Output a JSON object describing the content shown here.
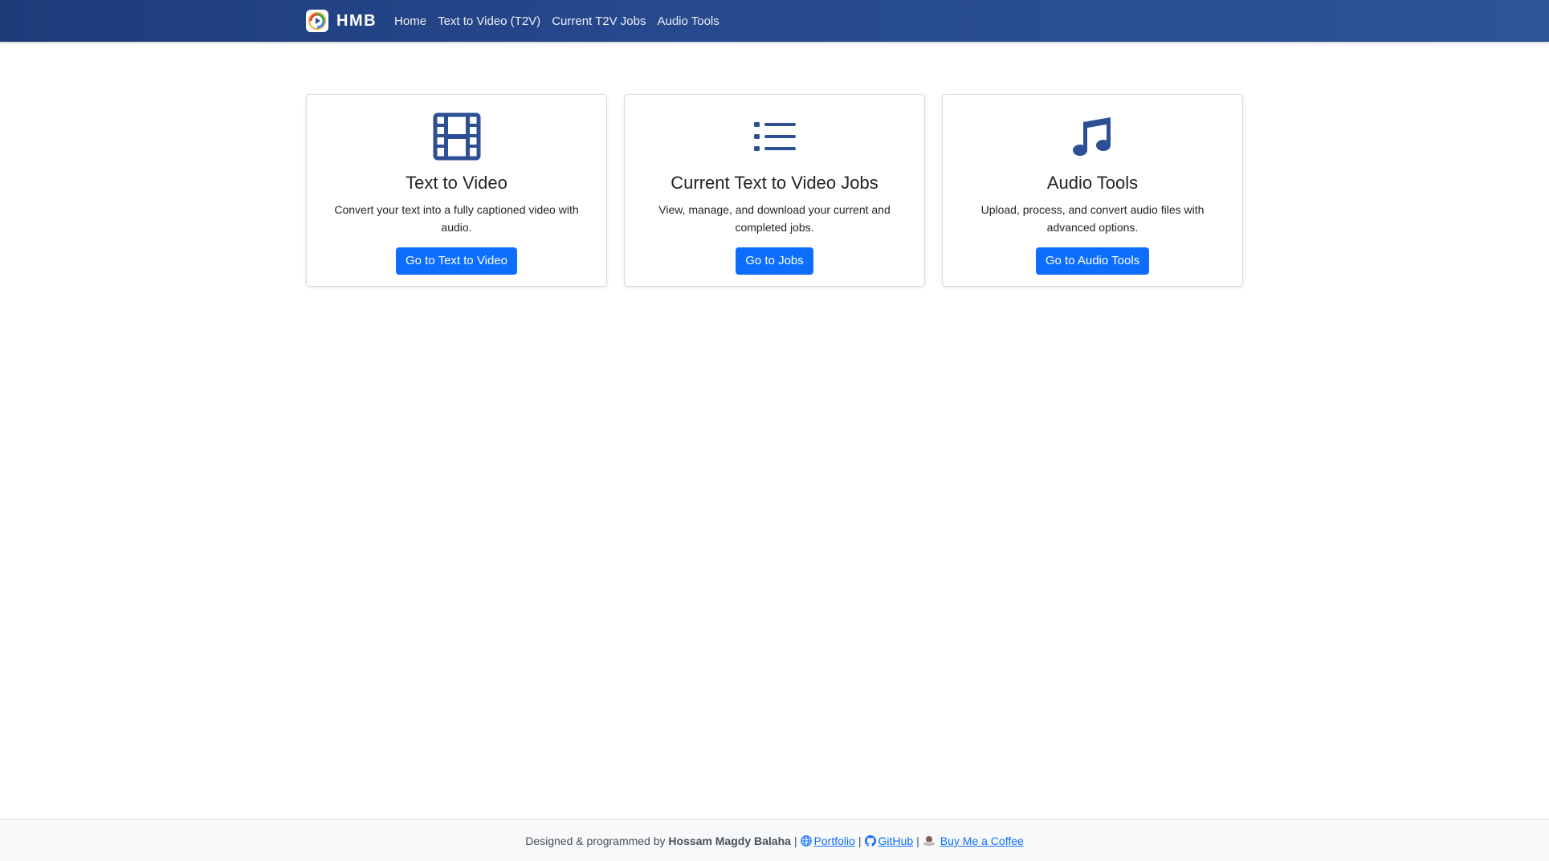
{
  "colors": {
    "navbar_start": "#1d3c7a",
    "navbar_end": "#2c5496",
    "icon_color": "#2d4f95",
    "button_primary": "#0d6efd",
    "link": "#0d6efd"
  },
  "navbar": {
    "brand": "HMB",
    "brand_icon": "hmb-logo-icon",
    "links": [
      {
        "label": "Home"
      },
      {
        "label": "Text to Video (T2V)"
      },
      {
        "label": "Current T2V Jobs"
      },
      {
        "label": "Audio Tools"
      }
    ]
  },
  "cards": [
    {
      "icon": "film-icon",
      "title": "Text to Video",
      "text": "Convert your text into a fully captioned video with audio.",
      "button": "Go to Text to Video"
    },
    {
      "icon": "list-icon",
      "title": "Current Text to Video Jobs",
      "text": "View, manage, and download your current and completed jobs.",
      "button": "Go to Jobs"
    },
    {
      "icon": "music-note-icon",
      "title": "Audio Tools",
      "text": "Upload, process, and convert audio files with advanced options.",
      "button": "Go to Audio Tools"
    }
  ],
  "footer": {
    "prefix": "Designed & programmed by",
    "author": "Hossam Magdy Balaha",
    "separator": "|",
    "links": [
      {
        "label": "Portfolio",
        "icon": "globe-icon"
      },
      {
        "label": "GitHub",
        "icon": "github-icon"
      },
      {
        "label": "Buy Me a Coffee",
        "icon": "coffee-icon"
      }
    ]
  }
}
